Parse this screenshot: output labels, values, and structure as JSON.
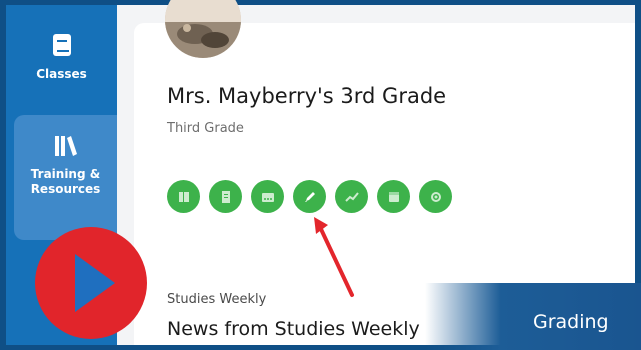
{
  "sidebar": {
    "items": [
      {
        "label": "Classes",
        "icon": "book-icon"
      },
      {
        "label_line1": "Training &",
        "label_line2": "Resources",
        "icon": "library-icon"
      }
    ]
  },
  "class_card": {
    "title": "Mrs. Mayberry's 3rd Grade",
    "subtitle": "Third Grade",
    "action_icons": [
      "book-icon",
      "document-icon",
      "roster-icon",
      "pencil-icon",
      "chart-icon",
      "calendar-icon",
      "settings-icon"
    ]
  },
  "news": {
    "label": "Studies Weekly",
    "title": "News from Studies Weekly"
  },
  "overlay": {
    "caption": "Grading",
    "play_icon": "play-icon",
    "pointer": "red-arrow-icon"
  },
  "colors": {
    "sidebar": "#1671b8",
    "sidebar_active": "#3f89c9",
    "action_green": "#3db24b",
    "play_red": "#e1252b",
    "arrow_red": "#e3262c"
  }
}
